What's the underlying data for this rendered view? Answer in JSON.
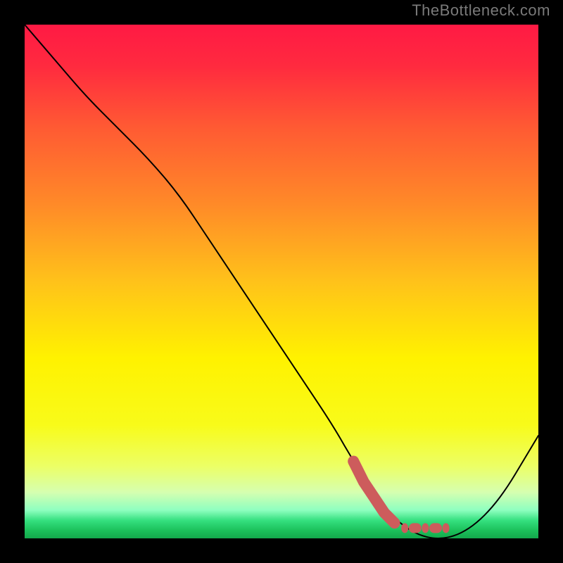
{
  "attribution": "TheBottleneck.com",
  "colors": {
    "frame": "#000000",
    "curve": "#000000",
    "marker": "#cd5c5c",
    "gradient_stops": [
      {
        "offset": 0.0,
        "color": "#ff1a44"
      },
      {
        "offset": 0.08,
        "color": "#ff2a3f"
      },
      {
        "offset": 0.2,
        "color": "#ff5a33"
      },
      {
        "offset": 0.35,
        "color": "#ff8a28"
      },
      {
        "offset": 0.5,
        "color": "#ffc21a"
      },
      {
        "offset": 0.65,
        "color": "#fff200"
      },
      {
        "offset": 0.78,
        "color": "#f8fb1a"
      },
      {
        "offset": 0.86,
        "color": "#ecff66"
      },
      {
        "offset": 0.91,
        "color": "#d6ffb0"
      },
      {
        "offset": 0.945,
        "color": "#8effc0"
      },
      {
        "offset": 0.965,
        "color": "#35e07f"
      },
      {
        "offset": 0.985,
        "color": "#1bc05a"
      },
      {
        "offset": 1.0,
        "color": "#13a84c"
      }
    ]
  },
  "chart_data": {
    "type": "line",
    "title": "",
    "xlabel": "",
    "ylabel": "",
    "xlim": [
      0,
      100
    ],
    "ylim": [
      0,
      100
    ],
    "series": [
      {
        "name": "bottleneck-curve",
        "x": [
          0,
          6,
          12,
          18,
          24,
          30,
          36,
          42,
          48,
          54,
          60,
          64,
          68,
          70,
          73,
          76,
          79,
          82,
          85,
          88,
          91,
          94,
          97,
          100
        ],
        "y": [
          100,
          93,
          86,
          80,
          74,
          67,
          58,
          49,
          40,
          31,
          22,
          15,
          9,
          6,
          3,
          1,
          0,
          0,
          1,
          3,
          6,
          10,
          15,
          20
        ]
      }
    ],
    "markers": {
      "name": "optimum-band",
      "style": "thick-dotted",
      "points": [
        {
          "x": 64,
          "y": 15
        },
        {
          "x": 66,
          "y": 11
        },
        {
          "x": 68,
          "y": 8
        },
        {
          "x": 70,
          "y": 5
        },
        {
          "x": 72,
          "y": 3
        },
        {
          "x": 74,
          "y": 2
        },
        {
          "x": 76,
          "y": 2
        },
        {
          "x": 78,
          "y": 2
        },
        {
          "x": 80,
          "y": 2
        },
        {
          "x": 82,
          "y": 2
        }
      ]
    }
  }
}
